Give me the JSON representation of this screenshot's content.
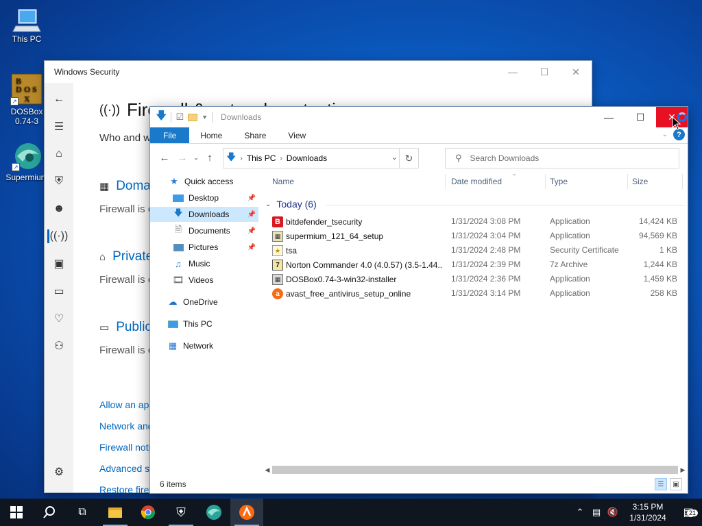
{
  "desktop": {
    "icons": [
      {
        "label": "This PC"
      },
      {
        "label": "DOSBox\n0.74-3"
      },
      {
        "label": "Supermium"
      }
    ]
  },
  "winsec": {
    "title": "Windows Security",
    "heading": "Firewall & network protection",
    "subtitle": "Who and what can access your networks.",
    "networks": [
      {
        "name": "Domain network",
        "desc": "Firewall is on."
      },
      {
        "name": "Private network",
        "desc": "Firewall is on."
      },
      {
        "name": "Public network",
        "desc": "Firewall is on."
      }
    ],
    "links": [
      "Allow an app through firewall",
      "Network and Internet troubleshooter",
      "Firewall notification settings",
      "Advanced settings",
      "Restore firewalls to default"
    ]
  },
  "explorer": {
    "title": "Downloads",
    "ribbon_tabs": [
      "File",
      "Home",
      "Share",
      "View"
    ],
    "breadcrumb": [
      "This PC",
      "Downloads"
    ],
    "search_placeholder": "Search Downloads",
    "nav": [
      {
        "label": "Quick access",
        "icon": "star-icon",
        "pinned": false
      },
      {
        "label": "Desktop",
        "icon": "desktop-folder-icon",
        "pinned": true
      },
      {
        "label": "Downloads",
        "icon": "downloads-folder-icon",
        "pinned": true
      },
      {
        "label": "Documents",
        "icon": "documents-folder-icon",
        "pinned": true
      },
      {
        "label": "Pictures",
        "icon": "pictures-folder-icon",
        "pinned": true
      },
      {
        "label": "Music",
        "icon": "music-folder-icon",
        "pinned": false
      },
      {
        "label": "Videos",
        "icon": "videos-folder-icon",
        "pinned": false
      },
      {
        "label": "OneDrive",
        "icon": "onedrive-icon",
        "pinned": false
      },
      {
        "label": "This PC",
        "icon": "this-pc-icon",
        "pinned": false
      },
      {
        "label": "Network",
        "icon": "network-icon",
        "pinned": false
      }
    ],
    "columns": [
      "Name",
      "Date modified",
      "Type",
      "Size"
    ],
    "group": "Today (6)",
    "files": [
      {
        "name": "bitdefender_tsecurity",
        "date": "1/31/2024 3:08 PM",
        "type": "Application",
        "size": "14,424 KB",
        "icon": "bitdefender-icon"
      },
      {
        "name": "supermium_121_64_setup",
        "date": "1/31/2024 3:04 PM",
        "type": "Application",
        "size": "94,569 KB",
        "icon": "installer-icon"
      },
      {
        "name": "tsa",
        "date": "1/31/2024 2:48 PM",
        "type": "Security Certificate",
        "size": "1 KB",
        "icon": "certificate-icon"
      },
      {
        "name": "Norton Commander 4.0 (4.0.57) (3.5-1.44...",
        "date": "1/31/2024 2:39 PM",
        "type": "7z Archive",
        "size": "1,244 KB",
        "icon": "archive-icon"
      },
      {
        "name": "DOSBox0.74-3-win32-installer",
        "date": "1/31/2024 2:36 PM",
        "type": "Application",
        "size": "1,459 KB",
        "icon": "installer-icon"
      },
      {
        "name": "avast_free_antivirus_setup_online",
        "date": "1/31/2024 3:14 PM",
        "type": "Application",
        "size": "258 KB",
        "icon": "avast-icon"
      }
    ],
    "status": "6 items"
  },
  "taskbar": {
    "time": "3:15 PM",
    "date": "1/31/2024",
    "notification_count": "21"
  }
}
